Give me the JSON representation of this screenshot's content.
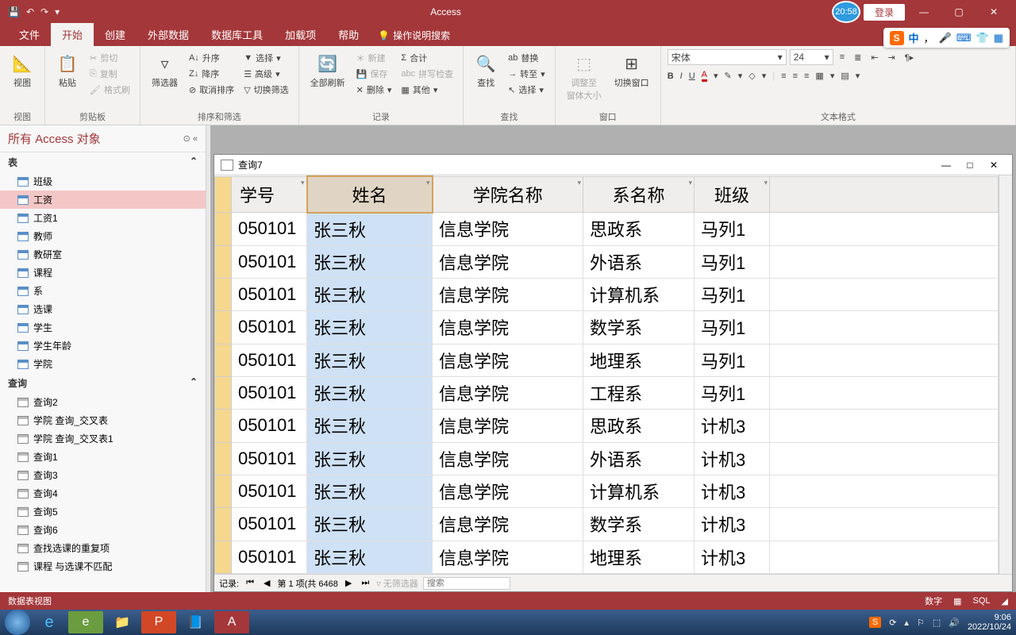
{
  "app": {
    "title": "Access",
    "time_badge": "20:58",
    "login": "登录"
  },
  "qat": {
    "save": "💾",
    "undo": "↶",
    "redo": "↷"
  },
  "tabs": [
    "文件",
    "开始",
    "创建",
    "外部数据",
    "数据库工具",
    "加载项",
    "帮助"
  ],
  "tabs_active": 1,
  "search_hint": "操作说明搜索",
  "sogou": {
    "label": "中"
  },
  "ribbon": {
    "groups": {
      "view": {
        "label": "视图",
        "btn": "视图"
      },
      "clipboard": {
        "label": "剪贴板",
        "paste": "粘贴",
        "cut": "剪切",
        "copy": "复制",
        "fmt": "格式刷"
      },
      "sort": {
        "label": "排序和筛选",
        "filter": "筛选器",
        "asc": "升序",
        "desc": "降序",
        "clear": "取消排序",
        "select": "选择",
        "adv": "高级",
        "toggle": "切换筛选"
      },
      "records": {
        "label": "记录",
        "refresh": "全部刷新",
        "new": "新建",
        "save": "保存",
        "delete": "删除",
        "totals": "合计",
        "spell": "拼写检查",
        "more": "其他"
      },
      "find": {
        "label": "查找",
        "find": "查找",
        "replace": "替换",
        "goto": "转至",
        "select": "选择"
      },
      "window": {
        "label": "窗口",
        "fit": "调整至\n窗体大小",
        "switch": "切换窗口"
      },
      "format": {
        "label": "文本格式",
        "font": "宋体",
        "size": "24"
      }
    }
  },
  "nav": {
    "header": "所有 Access 对象",
    "sections": {
      "tables": {
        "label": "表",
        "items": [
          "班级",
          "工资",
          "工资1",
          "教师",
          "教研室",
          "课程",
          "系",
          "选课",
          "学生",
          "学生年龄",
          "学院"
        ],
        "selected": 1
      },
      "queries": {
        "label": "查询",
        "items": [
          "查询2",
          "学院 查询_交叉表",
          "学院 查询_交叉表1",
          "查询1",
          "查询3",
          "查询4",
          "查询5",
          "查询6",
          "查找选课的重复项",
          "课程 与选课不匹配"
        ]
      }
    }
  },
  "doc": {
    "title": "查询7",
    "columns": [
      "学号",
      "姓名",
      "学院名称",
      "系名称",
      "班级"
    ],
    "selected_col": 1,
    "rows": [
      [
        "050101",
        "张三秋",
        "信息学院",
        "思政系",
        "马列1"
      ],
      [
        "050101",
        "张三秋",
        "信息学院",
        "外语系",
        "马列1"
      ],
      [
        "050101",
        "张三秋",
        "信息学院",
        "计算机系",
        "马列1"
      ],
      [
        "050101",
        "张三秋",
        "信息学院",
        "数学系",
        "马列1"
      ],
      [
        "050101",
        "张三秋",
        "信息学院",
        "地理系",
        "马列1"
      ],
      [
        "050101",
        "张三秋",
        "信息学院",
        "工程系",
        "马列1"
      ],
      [
        "050101",
        "张三秋",
        "信息学院",
        "思政系",
        "计机3"
      ],
      [
        "050101",
        "张三秋",
        "信息学院",
        "外语系",
        "计机3"
      ],
      [
        "050101",
        "张三秋",
        "信息学院",
        "计算机系",
        "计机3"
      ],
      [
        "050101",
        "张三秋",
        "信息学院",
        "数学系",
        "计机3"
      ],
      [
        "050101",
        "张三秋",
        "信息学院",
        "地理系",
        "计机3"
      ]
    ],
    "record_nav": {
      "label": "记录:",
      "position": "第 1 项(共 6468",
      "nofilter": "无筛选器",
      "search": "搜索"
    }
  },
  "statusbar": {
    "left": "数据表视图",
    "num": "数字",
    "sql": "SQL"
  },
  "taskbar": {
    "time": "9:06",
    "date": "2022/10/24"
  }
}
